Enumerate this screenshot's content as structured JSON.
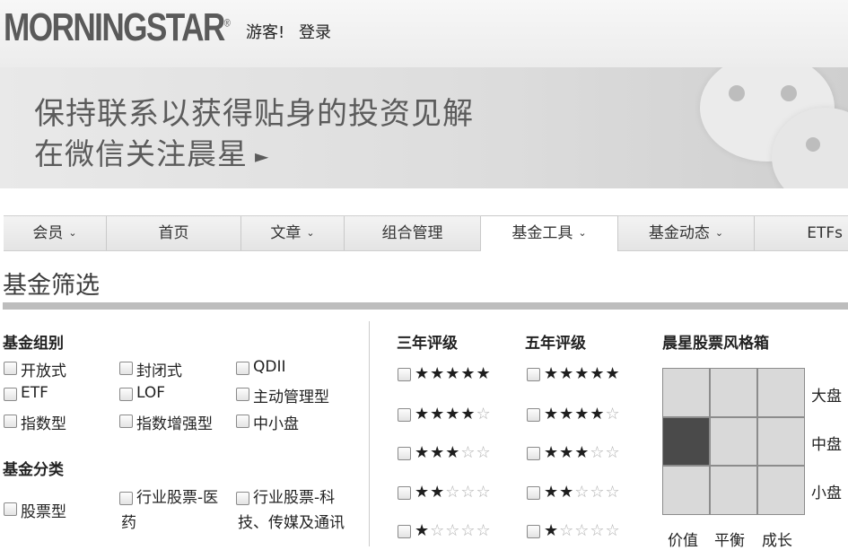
{
  "header": {
    "logo": "MORNINGSTAR",
    "logo_reg": "®",
    "guest": "游客!",
    "login": "登录"
  },
  "banner": {
    "line1": "保持联系以获得贴身的投资见解",
    "line2": "在微信关注晨星",
    "arrow": "►"
  },
  "nav": {
    "items": [
      {
        "label": "会员",
        "chev": "⌄"
      },
      {
        "label": "首页",
        "chev": ""
      },
      {
        "label": "文章",
        "chev": "⌄"
      },
      {
        "label": "组合管理",
        "chev": ""
      },
      {
        "label": "基金工具",
        "chev": "⌄"
      },
      {
        "label": "基金动态",
        "chev": "⌄"
      },
      {
        "label": "ETFs",
        "chev": ""
      }
    ],
    "active_index": 4
  },
  "page_title": "基金筛选",
  "fund_group": {
    "heading": "基金组别",
    "options": [
      "开放式",
      "封闭式",
      "QDII",
      "ETF",
      "LOF",
      "主动管理型",
      "指数型",
      "指数增强型",
      "中小盘"
    ]
  },
  "fund_category": {
    "heading": "基金分类",
    "options": [
      "股票型",
      "行业股票-医药",
      "行业股票-科技、传媒及通讯"
    ],
    "opt2_line1": "行业股票-医",
    "opt2_line2": "药",
    "opt3_line1": "行业股票-科",
    "opt3_line2": "技、传媒及通讯"
  },
  "rating3": {
    "heading": "三年评级",
    "rows": [
      {
        "filled": "★★★★★",
        "empty": ""
      },
      {
        "filled": "★★★★",
        "empty": "☆"
      },
      {
        "filled": "★★★",
        "empty": "☆☆"
      },
      {
        "filled": "★★",
        "empty": "☆☆☆"
      },
      {
        "filled": "★",
        "empty": "☆☆☆☆"
      }
    ]
  },
  "rating5": {
    "heading": "五年评级",
    "rows": [
      {
        "filled": "★★★★★",
        "empty": ""
      },
      {
        "filled": "★★★★",
        "empty": "☆"
      },
      {
        "filled": "★★★",
        "empty": "☆☆"
      },
      {
        "filled": "★★",
        "empty": "☆☆☆"
      },
      {
        "filled": "★",
        "empty": "☆☆☆☆"
      }
    ]
  },
  "stylebox": {
    "heading": "晨星股票风格箱",
    "sizes": [
      "大盘",
      "中盘",
      "小盘"
    ],
    "styles": [
      "价值",
      "平衡",
      "成长"
    ],
    "selected_cell": "中盘-价值"
  }
}
